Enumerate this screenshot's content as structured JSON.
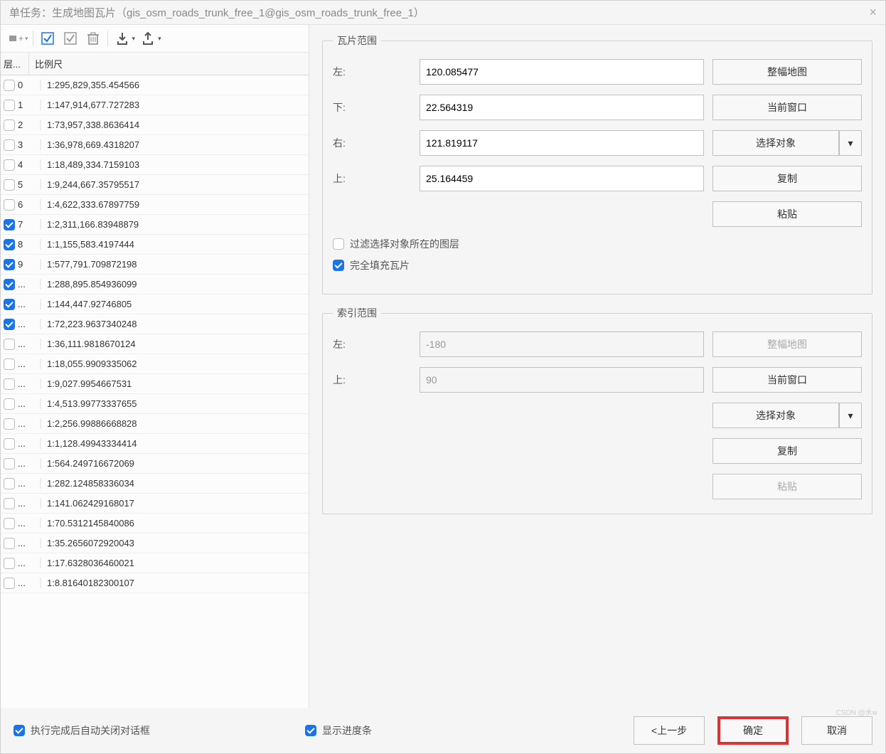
{
  "title": "单任务：生成地图瓦片（gis_osm_roads_trunk_free_1@gis_osm_roads_trunk_free_1）",
  "table": {
    "col_level": "层...",
    "col_scale": "比例尺",
    "rows": [
      {
        "level": "0",
        "scale": "1:295,829,355.454566",
        "checked": false
      },
      {
        "level": "1",
        "scale": "1:147,914,677.727283",
        "checked": false
      },
      {
        "level": "2",
        "scale": "1:73,957,338.8636414",
        "checked": false
      },
      {
        "level": "3",
        "scale": "1:36,978,669.4318207",
        "checked": false
      },
      {
        "level": "4",
        "scale": "1:18,489,334.7159103",
        "checked": false
      },
      {
        "level": "5",
        "scale": "1:9,244,667.35795517",
        "checked": false
      },
      {
        "level": "6",
        "scale": "1:4,622,333.67897759",
        "checked": false
      },
      {
        "level": "7",
        "scale": "1:2,311,166.83948879",
        "checked": true
      },
      {
        "level": "8",
        "scale": "1:1,155,583.4197444",
        "checked": true
      },
      {
        "level": "9",
        "scale": "1:577,791.709872198",
        "checked": true
      },
      {
        "level": "...",
        "scale": "1:288,895.854936099",
        "checked": true
      },
      {
        "level": "...",
        "scale": "1:144,447.92746805",
        "checked": true
      },
      {
        "level": "...",
        "scale": "1:72,223.9637340248",
        "checked": true
      },
      {
        "level": "...",
        "scale": "1:36,111.9818670124",
        "checked": false
      },
      {
        "level": "...",
        "scale": "1:18,055.9909335062",
        "checked": false
      },
      {
        "level": "...",
        "scale": "1:9,027.9954667531",
        "checked": false
      },
      {
        "level": "...",
        "scale": "1:4,513.99773337655",
        "checked": false
      },
      {
        "level": "...",
        "scale": "1:2,256.99886668828",
        "checked": false
      },
      {
        "level": "...",
        "scale": "1:1,128.49943334414",
        "checked": false
      },
      {
        "level": "...",
        "scale": "1:564.249716672069",
        "checked": false
      },
      {
        "level": "...",
        "scale": "1:282.124858336034",
        "checked": false
      },
      {
        "level": "...",
        "scale": "1:141.062429168017",
        "checked": false
      },
      {
        "level": "...",
        "scale": "1:70.5312145840086",
        "checked": false
      },
      {
        "level": "...",
        "scale": "1:35.2656072920043",
        "checked": false
      },
      {
        "level": "...",
        "scale": "1:17.6328036460021",
        "checked": false
      },
      {
        "level": "...",
        "scale": "1:8.81640182300107",
        "checked": false
      }
    ]
  },
  "tile_extent": {
    "legend": "瓦片范围",
    "left_label": "左:",
    "left_value": "120.085477",
    "bottom_label": "下:",
    "bottom_value": "22.564319",
    "right_label": "右:",
    "right_value": "121.819117",
    "top_label": "上:",
    "top_value": "25.164459",
    "filter_label": "过滤选择对象所在的图层",
    "filter_checked": false,
    "fill_label": "完全填充瓦片",
    "fill_checked": true,
    "btn_full_map": "整幅地图",
    "btn_current_window": "当前窗口",
    "btn_select_object": "选择对象",
    "btn_copy": "复制",
    "btn_paste": "粘贴"
  },
  "index_extent": {
    "legend": "索引范围",
    "left_label": "左:",
    "left_value": "-180",
    "top_label": "上:",
    "top_value": "90",
    "btn_full_map": "整幅地图",
    "btn_current_window": "当前窗口",
    "btn_select_object": "选择对象",
    "btn_copy": "复制",
    "btn_paste": "粘贴"
  },
  "footer": {
    "close_after_label": "执行完成后自动关闭对话框",
    "close_after_checked": true,
    "show_progress_label": "显示进度条",
    "show_progress_checked": true,
    "btn_prev": "<上一步",
    "btn_ok": "确定",
    "btn_cancel": "取消"
  },
  "watermark": "CSDN @水w"
}
